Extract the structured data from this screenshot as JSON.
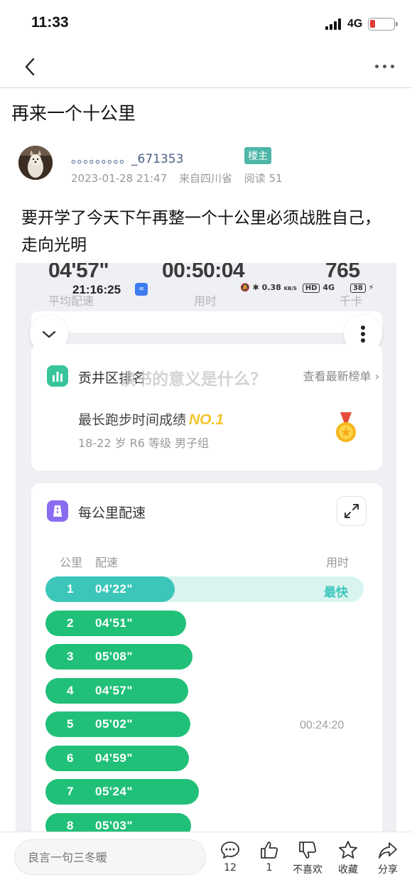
{
  "status_bar": {
    "time": "11:33",
    "network": "4G"
  },
  "post": {
    "title": "再来一个十公里",
    "author": "。。。。。。。。。_671353",
    "author_badge": "楼主",
    "date": "2023-01-28 21:47",
    "location": "来自四川省",
    "views": "阅读 51",
    "body": "要开学了今天下午再整一个十公里必须战胜自己，走向光明"
  },
  "screenshot": {
    "top_stats": [
      {
        "value": "04'57\"",
        "label": "平均配速"
      },
      {
        "value": "00:50:04",
        "label": "用时"
      },
      {
        "value": "765",
        "label": "千卡"
      }
    ],
    "phone_clock": "21:16:25",
    "status_icons": {
      "net_speed": "0.38",
      "net_unit": "KB/S",
      "hd": "HD",
      "signal": "4G",
      "battery": "38"
    },
    "ranking": {
      "title": "贡井区排名",
      "link": "查看最新榜单",
      "watermark": "读书的意义是什么？",
      "best_label": "最长跑步时间成绩",
      "best_rank": "NO.1",
      "group": "18-22 岁 R6 等级 男子组"
    },
    "pace": {
      "title": "每公里配速",
      "col_km": "公里",
      "col_pace": "配速",
      "col_time": "用时",
      "fastest_label": "最快",
      "split_time": "00:24:20",
      "rows": [
        {
          "km": "1",
          "pace": "04'22\""
        },
        {
          "km": "2",
          "pace": "04'51\""
        },
        {
          "km": "3",
          "pace": "05'08\""
        },
        {
          "km": "4",
          "pace": "04'57\""
        },
        {
          "km": "5",
          "pace": "05'02\""
        },
        {
          "km": "6",
          "pace": "04'59\""
        },
        {
          "km": "7",
          "pace": "05'24\""
        },
        {
          "km": "8",
          "pace": "05'03\""
        }
      ]
    }
  },
  "bottom_bar": {
    "comment_placeholder": "良言一句三冬暖",
    "actions": [
      {
        "icon": "comment-icon",
        "label": "12"
      },
      {
        "icon": "thumbs-up-icon",
        "label": "1"
      },
      {
        "icon": "thumbs-down-icon",
        "label": "不喜欢"
      },
      {
        "icon": "star-icon",
        "label": "收藏"
      },
      {
        "icon": "share-icon",
        "label": "分享"
      }
    ]
  },
  "colors": {
    "accent": "#4db6a7",
    "pace_bar": "#21c079",
    "fastest_bar": "#3cc6ba",
    "author_link": "#4a5f8a"
  }
}
